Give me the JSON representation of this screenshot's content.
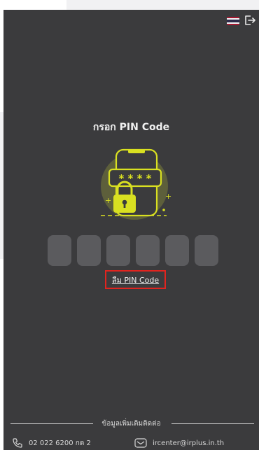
{
  "header": {
    "flag_icon": "thailand-flag-icon",
    "logout_icon": "logout-icon",
    "flag_colors": [
      "#a51931",
      "#f4f5f8",
      "#2d2a4a",
      "#f4f5f8",
      "#a51931"
    ]
  },
  "main": {
    "title": "กรอก PIN Code",
    "illustration_icon": "phone-lock-pin-illustration",
    "pin_asterisks": "* * * *",
    "pin_length": 6,
    "forgot_pin_link": "ลืม PIN Code"
  },
  "footer": {
    "title": "ข้อมูลเพิ่มเติมติดต่อ",
    "phone_icon": "phone-icon",
    "phone": "02 022 6200 กด 2",
    "email_icon": "email-icon",
    "email": "ircenter@irplus.in.th"
  },
  "colors": {
    "screen_bg": "#3b3b3d",
    "pin_box_bg": "#5b5b5e",
    "accent_yellow": "#d9e021",
    "highlight_red": "#e0241f"
  }
}
